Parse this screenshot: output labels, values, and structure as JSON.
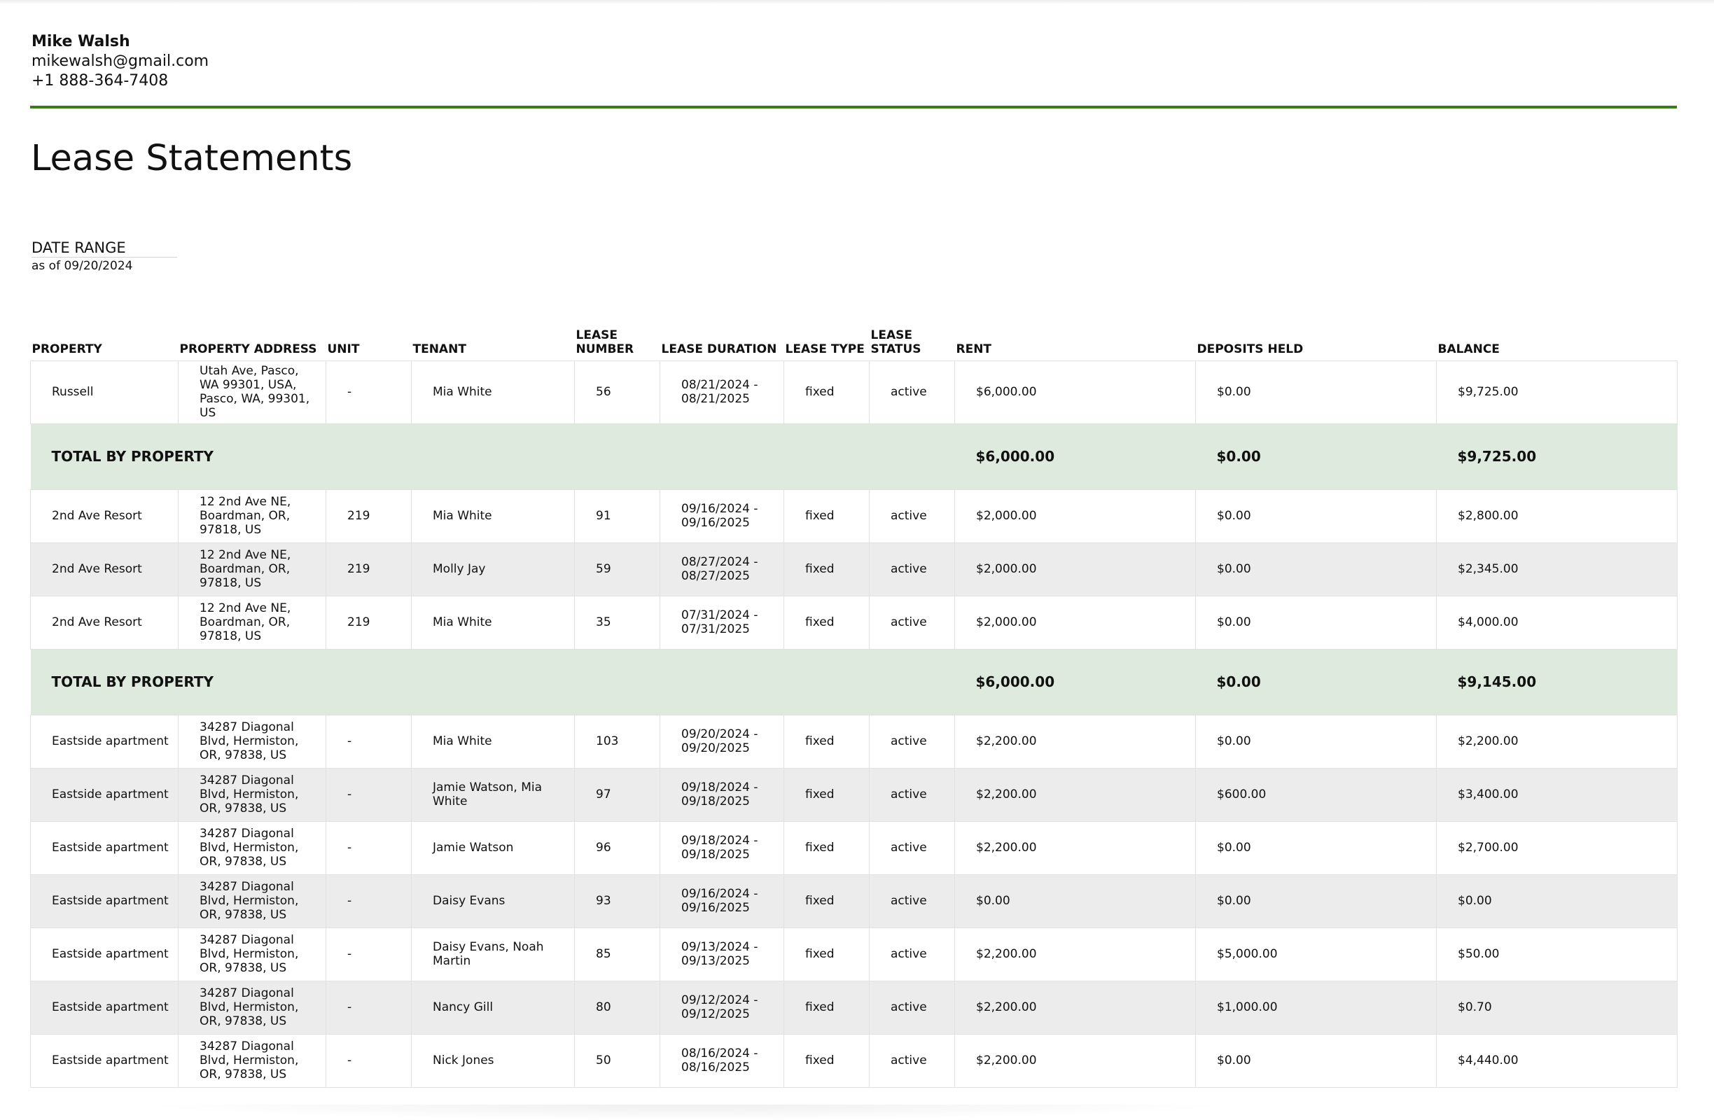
{
  "owner": {
    "name": "Mike Walsh",
    "email": "mikewalsh@gmail.com",
    "phone": "+1 888-364-7408"
  },
  "colors": {
    "accent": "#3c7a1a",
    "total_row": "#deeadd",
    "stripe": "#ececec"
  },
  "page_title": "Lease Statements",
  "date_range": {
    "label": "DATE RANGE",
    "value": "as of 09/20/2024"
  },
  "table": {
    "columns": [
      "PROPERTY",
      "PROPERTY ADDRESS",
      "UNIT",
      "TENANT",
      "LEASE NUMBER",
      "LEASE DURATION",
      "LEASE TYPE",
      "LEASE STATUS",
      "RENT",
      "DEPOSITS HELD",
      "BALANCE"
    ],
    "groups": [
      {
        "rows": [
          [
            "Russell",
            "Utah Ave, Pasco, WA 99301, USA, Pasco, WA, 99301, US",
            "-",
            "Mia White",
            "56",
            "08/21/2024 - 08/21/2025",
            "fixed",
            "active",
            "$6,000.00",
            "$0.00",
            "$9,725.00"
          ]
        ],
        "total": {
          "label": "TOTAL BY PROPERTY",
          "rent": "$6,000.00",
          "deposits": "$0.00",
          "balance": "$9,725.00"
        }
      },
      {
        "rows": [
          [
            "2nd Ave Resort",
            "12 2nd Ave NE, Boardman, OR, 97818, US",
            "219",
            "Mia White",
            "91",
            "09/16/2024 - 09/16/2025",
            "fixed",
            "active",
            "$2,000.00",
            "$0.00",
            "$2,800.00"
          ],
          [
            "2nd Ave Resort",
            "12 2nd Ave NE, Boardman, OR, 97818, US",
            "219",
            "Molly Jay",
            "59",
            "08/27/2024 - 08/27/2025",
            "fixed",
            "active",
            "$2,000.00",
            "$0.00",
            "$2,345.00"
          ],
          [
            "2nd Ave Resort",
            "12 2nd Ave NE, Boardman, OR, 97818, US",
            "219",
            "Mia White",
            "35",
            "07/31/2024 - 07/31/2025",
            "fixed",
            "active",
            "$2,000.00",
            "$0.00",
            "$4,000.00"
          ]
        ],
        "total": {
          "label": "TOTAL BY PROPERTY",
          "rent": "$6,000.00",
          "deposits": "$0.00",
          "balance": "$9,145.00"
        }
      },
      {
        "rows": [
          [
            "Eastside apartment",
            "34287 Diagonal Blvd, Hermiston, OR, 97838, US",
            "-",
            "Mia White",
            "103",
            "09/20/2024 - 09/20/2025",
            "fixed",
            "active",
            "$2,200.00",
            "$0.00",
            "$2,200.00"
          ],
          [
            "Eastside apartment",
            "34287 Diagonal Blvd, Hermiston, OR, 97838, US",
            "-",
            "Jamie Watson, Mia White",
            "97",
            "09/18/2024 - 09/18/2025",
            "fixed",
            "active",
            "$2,200.00",
            "$600.00",
            "$3,400.00"
          ],
          [
            "Eastside apartment",
            "34287 Diagonal Blvd, Hermiston, OR, 97838, US",
            "-",
            "Jamie Watson",
            "96",
            "09/18/2024 - 09/18/2025",
            "fixed",
            "active",
            "$2,200.00",
            "$0.00",
            "$2,700.00"
          ],
          [
            "Eastside apartment",
            "34287 Diagonal Blvd, Hermiston, OR, 97838, US",
            "-",
            "Daisy Evans",
            "93",
            "09/16/2024 - 09/16/2025",
            "fixed",
            "active",
            "$0.00",
            "$0.00",
            "$0.00"
          ],
          [
            "Eastside apartment",
            "34287 Diagonal Blvd, Hermiston, OR, 97838, US",
            "-",
            "Daisy Evans, Noah Martin",
            "85",
            "09/13/2024 - 09/13/2025",
            "fixed",
            "active",
            "$2,200.00",
            "$5,000.00",
            "$50.00"
          ],
          [
            "Eastside apartment",
            "34287 Diagonal Blvd, Hermiston, OR, 97838, US",
            "-",
            "Nancy Gill",
            "80",
            "09/12/2024 - 09/12/2025",
            "fixed",
            "active",
            "$2,200.00",
            "$1,000.00",
            "$0.70"
          ],
          [
            "Eastside apartment",
            "34287 Diagonal Blvd, Hermiston, OR, 97838, US",
            "-",
            "Nick Jones",
            "50",
            "08/16/2024 - 08/16/2025",
            "fixed",
            "active",
            "$2,200.00",
            "$0.00",
            "$4,440.00"
          ]
        ]
      }
    ]
  }
}
